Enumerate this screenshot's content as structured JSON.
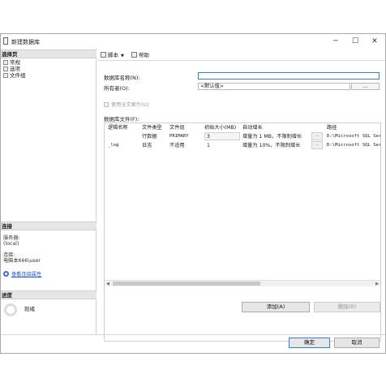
{
  "window": {
    "title": "新建数据库",
    "controls": {
      "minimize": "─",
      "maximize": "☐",
      "close": "✕"
    }
  },
  "left": {
    "pages_header": "选择页",
    "pages": [
      "常规",
      "选项",
      "文件组"
    ],
    "connection_header": "连接",
    "server_label": "服务器:",
    "server_value": "(local)",
    "conn_label": "连接:",
    "conn_value": "电脑本666\\user",
    "view_conn_link": "查看连接属性",
    "progress_header": "进度",
    "progress_status": "就绪"
  },
  "toolbar": {
    "script_label": "脚本",
    "help_label": "帮助"
  },
  "form": {
    "db_name_label": "数据库名称(N):",
    "db_name_value": "",
    "owner_label": "所有者(O):",
    "owner_value": "<默认值>",
    "owner_btn": "...",
    "fulltext_label": "使用全文索引(U)",
    "files_label": "数据库文件(F):"
  },
  "grid": {
    "columns": [
      "逻辑名称",
      "文件类型",
      "文件组",
      "初始大小(MB)",
      "自动增长",
      "路径"
    ],
    "rows": [
      {
        "name": "",
        "type": "行数据",
        "group": "PRIMARY",
        "size": "3",
        "growth": "增量为 1 MB，不限制增长",
        "path": "D:\\Microsoft SQL Serv"
      },
      {
        "name": "_log",
        "type": "日志",
        "group": "不适用",
        "size": "1",
        "growth": "增量为 10%，不限制增长",
        "path": "D:\\Microsoft SQL Serv"
      }
    ]
  },
  "buttons": {
    "add": "添加(A)",
    "remove": "删除(R)",
    "ok": "确定",
    "cancel": "取消"
  }
}
